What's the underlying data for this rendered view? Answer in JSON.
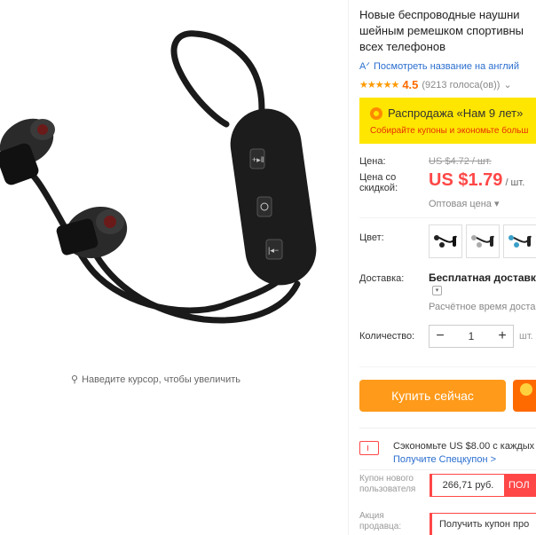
{
  "product": {
    "title_lines": [
      "Новые беспроводные наушни",
      "шейным ремешком спортивны",
      "всех телефонов"
    ],
    "translate_link": "Посмотреть название на англий",
    "rating": {
      "stars": 4.5,
      "value": "4.5",
      "votes": "(9213 голоса(ов))"
    }
  },
  "image": {
    "zoom_hint": "Наведите курсор, чтобы увеличить"
  },
  "sale": {
    "title": "Распродажа «Нам 9 лет»",
    "subtitle": "Собирайте купоны и экономьте больш"
  },
  "price": {
    "label": "Цена:",
    "old": "US $4.72 / шт.",
    "discount_label": "Цена со скидкой:",
    "new_amount": "US $1.79",
    "new_unit": " / шт.",
    "wholesale": "Оптовая цена"
  },
  "color": {
    "label": "Цвет:",
    "options": [
      "black",
      "silver",
      "blue"
    ]
  },
  "shipping": {
    "label": "Доставка:",
    "value": "Бесплатная доставка",
    "time": "Расчётное время доставк"
  },
  "quantity": {
    "label": "Количество:",
    "minus": "−",
    "value": "1",
    "plus": "+",
    "unit": "шт."
  },
  "actions": {
    "buy_now": "Купить сейчас"
  },
  "savings": {
    "text": "Сэкономьте US $8.00 с каждых",
    "link": "Получите Спецкупон >"
  },
  "new_user_coupon": {
    "label": "Купон нового пользователя",
    "value": "266,71 руб.",
    "get": "ПОЛ"
  },
  "seller_promo": {
    "label": "Акция продавца:",
    "value": "Получить купон про"
  },
  "colors": {
    "sale_bg": "#ffe600",
    "price_red": "#ff4747",
    "buy_orange": "#ff9a1a",
    "link_blue": "#2a6ecf"
  }
}
